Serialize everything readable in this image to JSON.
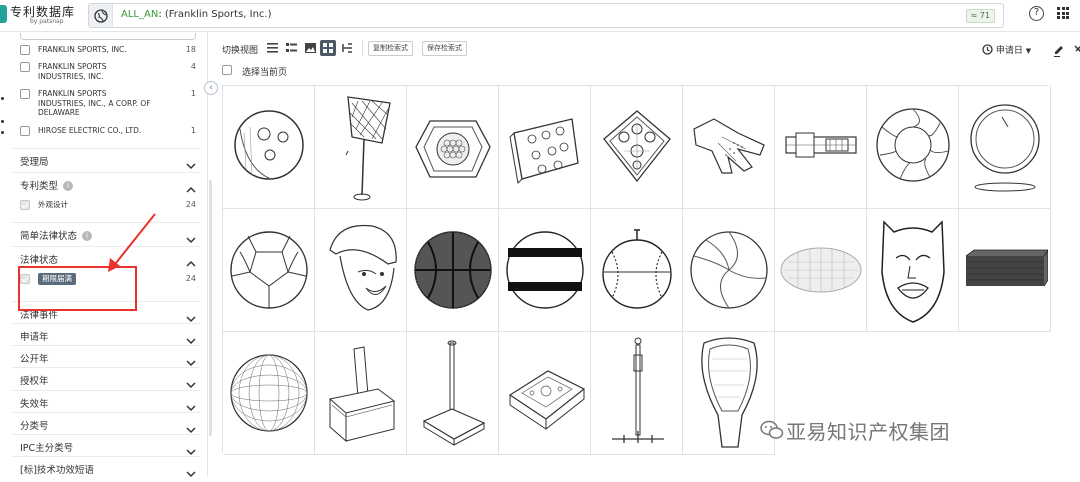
{
  "header": {
    "logo_title": "专利数据库",
    "logo_sub": "by patsnap",
    "query_field": "ALL_AN",
    "query_text": ": (Franklin Sports, Inc.)",
    "result_count": "≈ 71",
    "help_label": "?"
  },
  "sidebar": {
    "applicants": [
      {
        "label": "FRANKLIN SPORTS, INC.",
        "count": "18"
      },
      {
        "label": "FRANKLIN SPORTS INDUSTRIES, INC.",
        "count": "4"
      },
      {
        "label": "FRANKLIN SPORTS INDUSTRIES, INC., A CORP. OF DELAWARE",
        "count": "1"
      },
      {
        "label": "HIROSE ELECTRIC CO., LTD.",
        "count": "1"
      }
    ],
    "sections": [
      {
        "label": "受理局"
      },
      {
        "label": "专利类型"
      },
      {
        "label": "简单法律状态"
      },
      {
        "label": "法律状态"
      },
      {
        "label": "法律事件"
      },
      {
        "label": "申请年"
      },
      {
        "label": "公开年"
      },
      {
        "label": "授权年"
      },
      {
        "label": "失效年"
      },
      {
        "label": "分类号"
      },
      {
        "label": "IPC主分类号"
      },
      {
        "label": "[标]技术功效短语"
      }
    ],
    "patent_type_option": {
      "label": "外观设计",
      "count": "24"
    },
    "legal_status_option": {
      "label": "期限届满",
      "count": "24"
    }
  },
  "toolbar": {
    "view_label": "切换视图",
    "copy_btn": "复制检索式",
    "save_btn": "保存检索式",
    "sort_label": "申请日",
    "select_page": "选择当前页"
  },
  "watermark": "亚易知识产权集团",
  "icons": [
    "globe-icon",
    "help-icon",
    "apps-icon",
    "chevron-down-icon",
    "chevron-up-icon",
    "info-icon",
    "list-view-icon",
    "card-view-icon",
    "image-view-icon",
    "grid-view-icon",
    "chart-view-icon",
    "sort-icon",
    "pen-icon"
  ],
  "images": [
    "hockey-puck-ball",
    "net-stand",
    "hexagon-grid",
    "pierced-plate",
    "base-plate",
    "glove",
    "clip-buckle",
    "swirl-ball",
    "round-frame",
    "soccer-ball",
    "cap-head",
    "basketball",
    "striped-ball",
    "baseball",
    "volleyball",
    "football",
    "mask",
    "textured-block",
    "mesh-sphere",
    "chair",
    "batting-tee-base",
    "game-board",
    "batting-tee",
    "lacrosse-head"
  ]
}
